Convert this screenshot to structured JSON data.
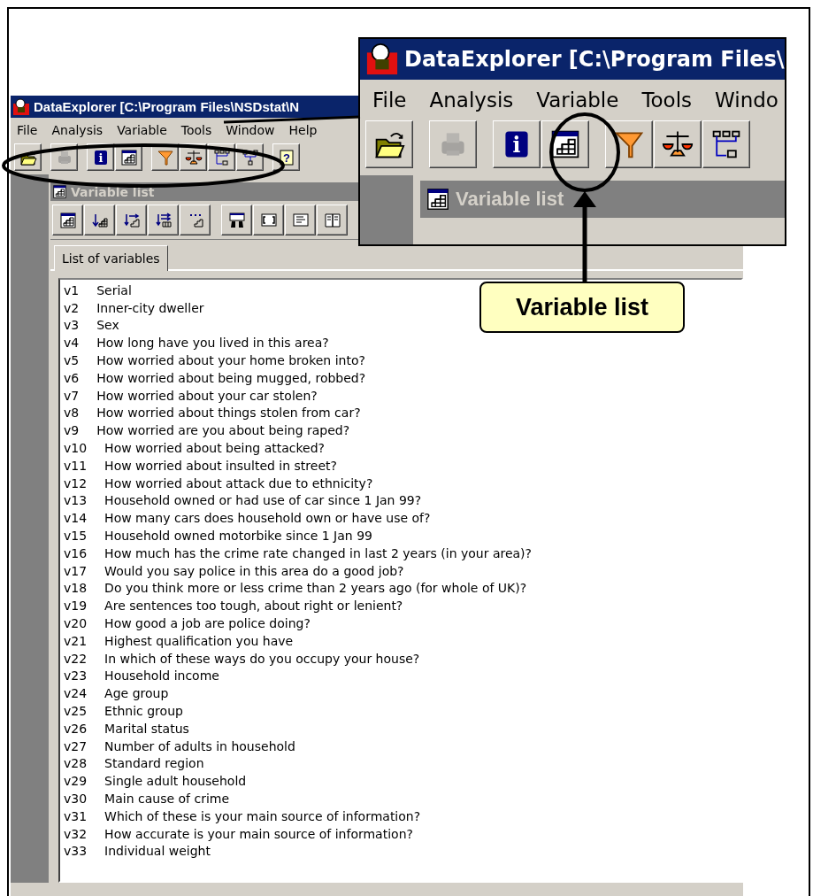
{
  "window": {
    "title": "DataExplorer [C:\\Program Files\\NSDstat\\N"
  },
  "menu": [
    "File",
    "Analysis",
    "Variable",
    "Tools",
    "Window",
    "Help"
  ],
  "toolbar": [
    [
      {
        "kind": "open",
        "disabled": false
      }
    ],
    [
      {
        "kind": "print",
        "disabled": true
      }
    ],
    [
      {
        "kind": "info",
        "disabled": false,
        "glyph": "i"
      },
      {
        "kind": "varlist",
        "disabled": false
      }
    ],
    [
      {
        "kind": "funnel",
        "disabled": false
      },
      {
        "kind": "scales",
        "disabled": false
      },
      {
        "kind": "tree",
        "disabled": false
      },
      {
        "kind": "tree2",
        "disabled": false
      }
    ],
    [
      {
        "kind": "help",
        "disabled": false,
        "glyph": "?"
      }
    ]
  ],
  "child_window": {
    "title": "Variable list",
    "toolbar": [
      [
        {
          "kind": "varlist",
          "disabled": false
        },
        {
          "kind": "sort",
          "disabled": false
        },
        {
          "kind": "move",
          "disabled": false
        },
        {
          "kind": "move2",
          "disabled": false
        },
        {
          "kind": "dots",
          "disabled": false
        }
      ],
      [
        {
          "kind": "binoculars",
          "disabled": false
        },
        {
          "kind": "frame",
          "disabled": false
        },
        {
          "kind": "card",
          "disabled": false
        },
        {
          "kind": "book",
          "disabled": false
        }
      ]
    ],
    "tabs": [
      {
        "label": "List of variables",
        "selected": true
      }
    ],
    "variables": [
      {
        "id": "v1",
        "label": "Serial"
      },
      {
        "id": "v2",
        "label": "Inner-city dweller"
      },
      {
        "id": "v3",
        "label": "Sex"
      },
      {
        "id": "v4",
        "label": "How long have you lived in this area?"
      },
      {
        "id": "v5",
        "label": "How worried about your home broken into?"
      },
      {
        "id": "v6",
        "label": "How worried about being mugged, robbed?"
      },
      {
        "id": "v7",
        "label": "How worried about your car stolen?"
      },
      {
        "id": "v8",
        "label": "How worried about things stolen from car?"
      },
      {
        "id": "v9",
        "label": "How worried are you about being raped?"
      },
      {
        "id": "v10",
        "label": "How worried about being attacked?"
      },
      {
        "id": "v11",
        "label": "How worried about insulted in street?"
      },
      {
        "id": "v12",
        "label": "How worried about attack due to ethnicity?"
      },
      {
        "id": "v13",
        "label": "Household owned or had use of car since 1 Jan 99?"
      },
      {
        "id": "v14",
        "label": "How many cars does household own or have use of?"
      },
      {
        "id": "v15",
        "label": "Household owned motorbike since 1 Jan 99"
      },
      {
        "id": "v16",
        "label": "How much has the crime rate changed in last 2 years (in your area)?"
      },
      {
        "id": "v17",
        "label": "Would you say police in this area do a good job?"
      },
      {
        "id": "v18",
        "label": "Do you think more or less crime than 2 years ago (for whole of UK)?"
      },
      {
        "id": "v19",
        "label": "Are sentences too tough, about right or lenient?"
      },
      {
        "id": "v20",
        "label": "How good a job are police doing?"
      },
      {
        "id": "v21",
        "label": "Highest qualification you have"
      },
      {
        "id": "v22",
        "label": "In which of these ways do you occupy your house?"
      },
      {
        "id": "v23",
        "label": "Household income"
      },
      {
        "id": "v24",
        "label": "Age group"
      },
      {
        "id": "v25",
        "label": "Ethnic group"
      },
      {
        "id": "v26",
        "label": "Marital status"
      },
      {
        "id": "v27",
        "label": "Number of adults in household"
      },
      {
        "id": "v28",
        "label": "Standard region"
      },
      {
        "id": "v29",
        "label": "Single adult household"
      },
      {
        "id": "v30",
        "label": "Main cause of crime"
      },
      {
        "id": "v31",
        "label": "Which of these is your main source of information?"
      },
      {
        "id": "v32",
        "label": "How accurate is your main source of information?"
      },
      {
        "id": "v33",
        "label": "Individual weight"
      }
    ]
  },
  "zoom_inset": {
    "title": "DataExplorer [C:\\Program Files\\",
    "menu": [
      "File",
      "Analysis",
      "Variable",
      "Tools",
      "Windo"
    ],
    "toolbar": [
      [
        {
          "kind": "open",
          "disabled": false
        }
      ],
      [
        {
          "kind": "print",
          "disabled": true
        }
      ],
      [
        {
          "kind": "info",
          "disabled": false,
          "glyph": "i"
        },
        {
          "kind": "varlist",
          "disabled": false
        }
      ],
      [
        {
          "kind": "funnel",
          "disabled": false
        },
        {
          "kind": "scales",
          "disabled": false
        },
        {
          "kind": "tree",
          "disabled": false
        }
      ]
    ],
    "child_title": "Variable list"
  },
  "callout": {
    "label": "Variable list"
  }
}
